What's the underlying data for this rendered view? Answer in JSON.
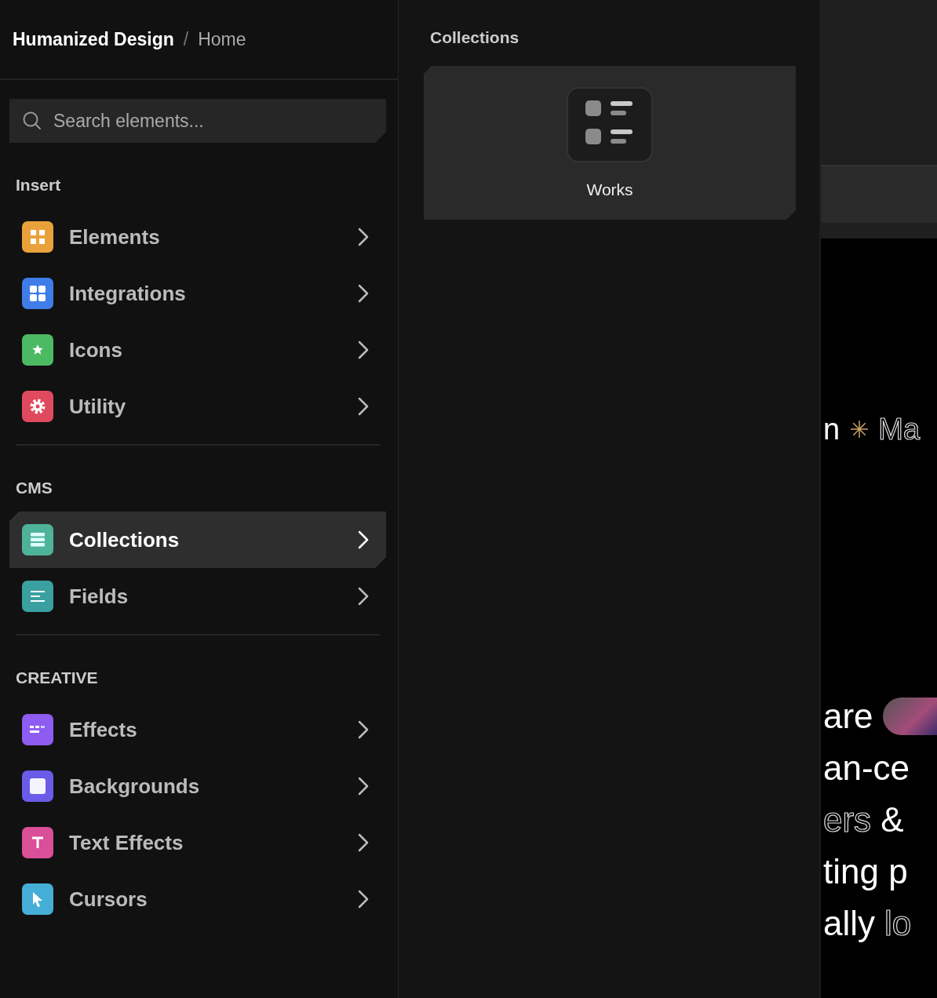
{
  "breadcrumb": {
    "site": "Humanized Design",
    "separator": "/",
    "page": "Home"
  },
  "search": {
    "placeholder": "Search elements..."
  },
  "sections": [
    {
      "title": "Insert",
      "items": [
        {
          "label": "Elements",
          "color": "#e9a23b",
          "selected": false
        },
        {
          "label": "Integrations",
          "color": "#3f7de8",
          "selected": false
        },
        {
          "label": "Icons",
          "color": "#4cb963",
          "selected": false
        },
        {
          "label": "Utility",
          "color": "#e04a5f",
          "selected": false
        }
      ]
    },
    {
      "title": "CMS",
      "items": [
        {
          "label": "Collections",
          "color": "#4fb39a",
          "selected": true
        },
        {
          "label": "Fields",
          "color": "#3aa0a0",
          "selected": false
        }
      ]
    },
    {
      "title": "CREATIVE",
      "items": [
        {
          "label": "Effects",
          "color": "#8e5cf0",
          "selected": false
        },
        {
          "label": "Backgrounds",
          "color": "#6a5ce8",
          "selected": false
        },
        {
          "label": "Text Effects",
          "color": "#d94f98",
          "selected": false
        },
        {
          "label": "Cursors",
          "color": "#45aed6",
          "selected": false
        }
      ]
    }
  ],
  "panel": {
    "title": "Collections",
    "cards": [
      {
        "label": "Works"
      }
    ]
  },
  "preview": {
    "lines": [
      {
        "parts": [
          {
            "text": "n",
            "outline": false
          },
          {
            "text": "✳",
            "accent": true
          },
          {
            "text": "Ma",
            "outline": true
          }
        ]
      },
      {
        "parts": [
          {
            "text": "are",
            "outline": false
          }
        ],
        "photo": true
      },
      {
        "parts": [
          {
            "text": "an-ce",
            "outline": false
          }
        ]
      },
      {
        "parts": [
          {
            "text": "ers",
            "outline": true
          },
          {
            "text": "&",
            "outline": false
          }
        ]
      },
      {
        "parts": [
          {
            "text": "ting p",
            "outline": false
          }
        ]
      },
      {
        "parts": [
          {
            "text": "ally",
            "outline": false
          },
          {
            "text": "lo",
            "outline": true
          }
        ]
      }
    ]
  }
}
